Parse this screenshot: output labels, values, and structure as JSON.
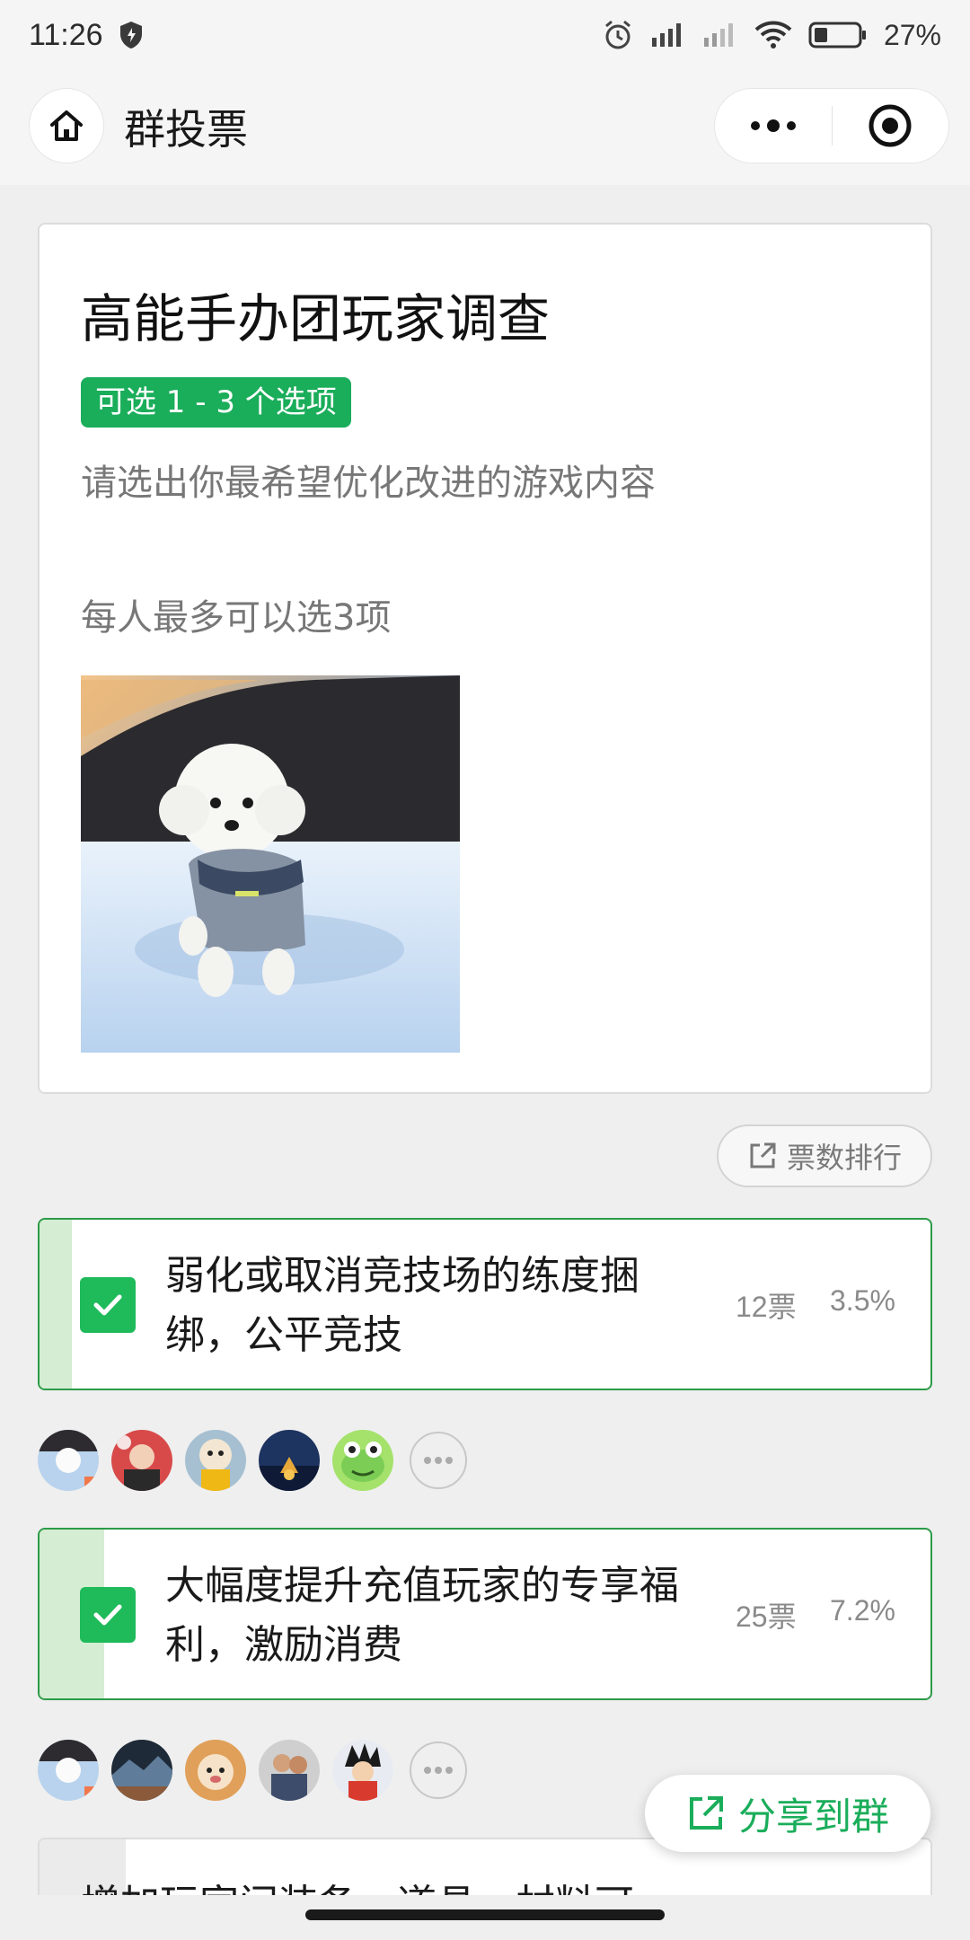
{
  "status_bar": {
    "time": "11:26",
    "battery": "27%"
  },
  "nav": {
    "title": "群投票",
    "icons": [
      "home-icon",
      "more-icon",
      "close-target-icon"
    ]
  },
  "poll": {
    "title": "高能手办团玩家调查",
    "badge": "可选 1 - 3 个选项",
    "description": "请选出你最希望优化改进的游戏内容",
    "note": "每人最多可以选3项"
  },
  "ranking_button": {
    "label": "票数排行"
  },
  "options": [
    {
      "text": "弱化或取消竞技场的练度捆绑，公平竞技",
      "votes": "12票",
      "percent": "3.5%",
      "percent_value": 3.5,
      "checked": true
    },
    {
      "text": "大幅度提升充值玩家的专享福利，激励消费",
      "votes": "25票",
      "percent": "7.2%",
      "percent_value": 7.2,
      "checked": true
    },
    {
      "text": "增加玩家间装备、道具、材料可",
      "checked": false
    }
  ],
  "share_button": {
    "label": "分享到群"
  },
  "colors": {
    "accent": "#1aad5a",
    "check": "#1fba5a",
    "option_border": "#2c9a47",
    "option_fill": "#d4edd3"
  }
}
